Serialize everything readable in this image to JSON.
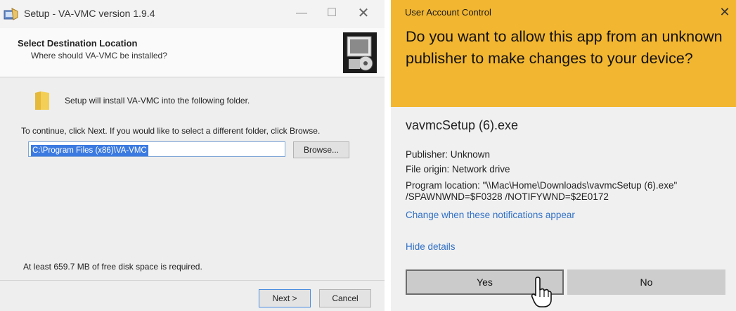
{
  "setup": {
    "window_title": "Setup - VA-VMC version 1.9.4",
    "heading": "Select Destination Location",
    "subheading": "Where should VA-VMC be installed?",
    "install_text": "Setup will install VA-VMC into the following folder.",
    "continue_text": "To continue, click Next. If you would like to select a different folder, click Browse.",
    "path_value": "C:\\Program Files (x86)\\VA-VMC",
    "browse_label": "Browse...",
    "space_text": "At least 659.7 MB of free disk space is required.",
    "next_label": "Next >",
    "cancel_label": "Cancel",
    "icons": [
      "setup-app-icon",
      "minimize-icon",
      "maximize-icon",
      "close-icon",
      "installer-logo-icon",
      "folder-icon"
    ]
  },
  "uac": {
    "title": "User Account Control",
    "question": "Do you want to allow this app from an unknown publisher to make changes to your device?",
    "file_name": "vavmcSetup (6).exe",
    "publisher": "Publisher: Unknown",
    "file_origin": "File origin: Network drive",
    "program_location": "Program location: \"\\\\Mac\\Home\\Downloads\\vavmcSetup (6).exe\" /SPAWNWND=$F0328 /NOTIFYWND=$2E0172",
    "change_link": "Change when these notifications appear",
    "hide_details": "Hide details",
    "yes_label": "Yes",
    "no_label": "No",
    "header_color": "#f2b631",
    "link_color": "#2f6fc6",
    "icons": [
      "close-icon",
      "mouse-pointer-icon"
    ]
  }
}
